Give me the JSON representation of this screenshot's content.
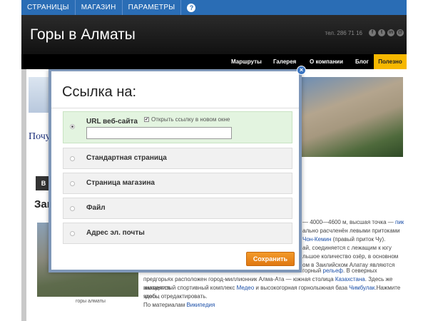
{
  "topnav": {
    "items": [
      "СТРАНИЦЫ",
      "МАГАЗИН",
      "ПАРАМЕТРЫ"
    ],
    "help_label": "?"
  },
  "header": {
    "title": "Горы в Алматы",
    "phone": "тел. 286 71 16",
    "socials": [
      "f",
      "t",
      "in",
      "@"
    ]
  },
  "mainnav": {
    "items": [
      "Маршруты",
      "Галерея",
      "О компании",
      "Блог"
    ],
    "highlight": "Полезно"
  },
  "page": {
    "hero_caption_partial": "Почу",
    "section_button": "В",
    "section_title_partial": "Зак",
    "thumb_caption": "горы алматы",
    "right_lines": [
      {
        "text": "— 4000—4600 м, высшая точка — ",
        "link": "пик"
      },
      {
        "text": "ально расчленён левыми притоками",
        "link": ""
      },
      {
        "text": "",
        "link": "Чон-Кемин",
        "after": " (правый приток Чу)."
      },
      {
        "text": "ай, соединяется с лежащим к югу",
        "link": ""
      },
      {
        "text": "льшое количество озёр, в основном",
        "link": ""
      },
      {
        "text": "ом в Заилийском Алатау являются",
        "link": ""
      },
      {
        "text": "горный ",
        "link": "рельеф",
        "after": ". В северных"
      }
    ],
    "body_lines": [
      {
        "text": "предгорьях расположен город-миллионник Алма-Ата — южная столица ",
        "link": "Казахстана",
        "after": ". Здесь же находятся"
      },
      {
        "text": "знаменитый спортивный комплекс ",
        "link": "Медео",
        "after": " и высокогорная горнолыжная база ",
        "link2": "Чимбулак",
        "after2": ".Нажмите здесь,"
      },
      {
        "text": "чтобы отредактировать.",
        "link": ""
      },
      {
        "text": "По материалам ",
        "link": "Википедия"
      }
    ]
  },
  "dialog": {
    "title": "Ссылка на:",
    "close_label": "×",
    "options": [
      {
        "label": "URL веб-сайта",
        "selected": true
      },
      {
        "label": "Стандартная страница",
        "selected": false
      },
      {
        "label": "Страница магазина",
        "selected": false
      },
      {
        "label": "Файл",
        "selected": false
      },
      {
        "label": "Адрес эл. почты",
        "selected": false
      }
    ],
    "new_window_label": "Открыть ссылку в новом окне",
    "new_window_checked": true,
    "url_value": "",
    "save_label": "Сохранить"
  },
  "colors": {
    "topnav": "#2a6db5",
    "save": "#e88a1e",
    "selected_option": "#e3f4e0",
    "useful": "#f6b800"
  }
}
